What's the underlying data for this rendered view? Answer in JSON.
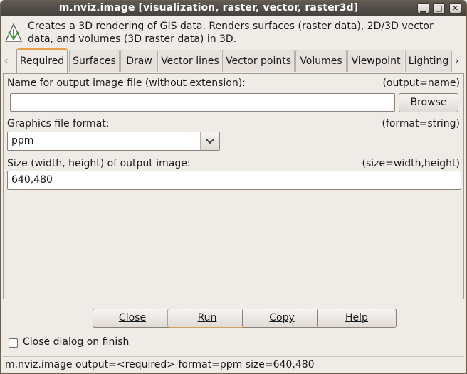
{
  "window": {
    "title": "m.nviz.image [visualization, raster, vector, raster3d]",
    "controls": {
      "minimize": "▁",
      "maximize": "□",
      "close": "✕"
    }
  },
  "description": "Creates a 3D rendering of GIS data. Renders surfaces (raster data), 2D/3D vector data, and volumes (3D raster data) in 3D.",
  "tabs": [
    {
      "label": "Required",
      "active": true
    },
    {
      "label": "Surfaces"
    },
    {
      "label": "Draw"
    },
    {
      "label": "Vector lines"
    },
    {
      "label": "Vector points"
    },
    {
      "label": "Volumes"
    },
    {
      "label": "Viewpoint"
    },
    {
      "label": "Lighting"
    }
  ],
  "arrows": {
    "left": "‹",
    "right": "›"
  },
  "fields": {
    "output": {
      "label": "Name for output image file (without extension):",
      "hint": "(output=name)",
      "value": "",
      "browse_label": "Browse"
    },
    "format": {
      "label": "Graphics file format:",
      "hint": "(format=string)",
      "value": "ppm"
    },
    "size": {
      "label": "Size (width, height) of output image:",
      "hint": "(size=width,height)",
      "value": "640,480"
    }
  },
  "buttons": {
    "close": "Close",
    "run": "Run",
    "copy": "Copy",
    "help": "Help"
  },
  "close_on_finish": {
    "label": "Close dialog on finish",
    "checked": false
  },
  "status": "m.nviz.image output=<required> format=ppm size=640,480",
  "colors": {
    "active_tab_accent": "#e6a14a",
    "titlebar": "#4f4a45"
  }
}
